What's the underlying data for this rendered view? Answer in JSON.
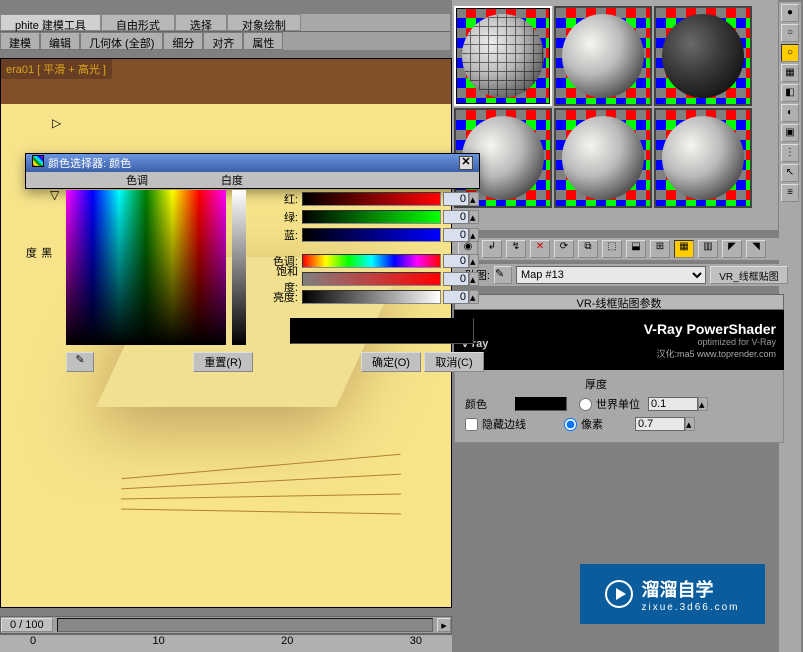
{
  "top_tabs": [
    "phite 建模工具",
    "自由形式",
    "选择",
    "对象绘制"
  ],
  "sub_tabs": [
    "建模",
    "编辑",
    "几何体 (全部)",
    "细分",
    "对齐",
    "属性"
  ],
  "viewport_label": "era01 [ 平滑 + 高光 ]",
  "color_picker": {
    "title": "颜色选择器: 颜色",
    "hue_label": "色调",
    "whiteness_label": "白度",
    "blackness_top": "黑",
    "blackness_bot": "度",
    "sliders": {
      "red": {
        "label": "红:",
        "value": "0"
      },
      "green": {
        "label": "绿:",
        "value": "0"
      },
      "blue": {
        "label": "蓝:",
        "value": "0"
      },
      "hue": {
        "label": "色调:",
        "value": "0"
      },
      "sat": {
        "label": "饱和度:",
        "value": "0"
      },
      "val": {
        "label": "亮度:",
        "value": "0"
      }
    },
    "reset": "重置(R)",
    "ok": "确定(O)",
    "cancel": "取消(C)"
  },
  "material": {
    "map_label": "贴图:",
    "map_value": "Map #13",
    "side_button": "VR_线框贴图",
    "rollout_title": "VR-线框贴图参数",
    "vray_brand": "v·ray",
    "vray_title": "V-Ray PowerShader",
    "vray_sub": "optimized for V-Ray",
    "vray_cn": "汉化:ma5  www.toprender.com",
    "color_label": "颜色",
    "hide_backline": "隐藏边线",
    "thickness_group": "厚度",
    "world_unit": "世界单位",
    "world_val": "0.1",
    "pixel_unit": "像素",
    "pixel_val": "0.7"
  },
  "watermark": {
    "big": "溜溜自学",
    "small": "zixue.3d66.com"
  },
  "timeline": {
    "frame": "0 / 100",
    "ticks": [
      "0",
      "10",
      "20",
      "30"
    ]
  }
}
